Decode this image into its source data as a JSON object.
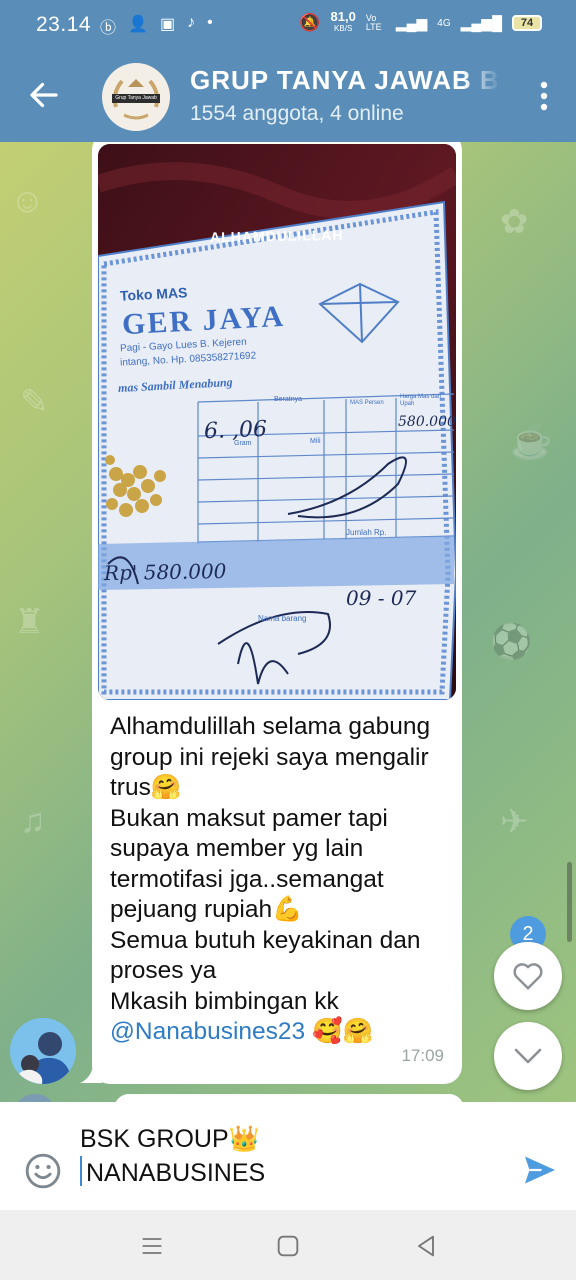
{
  "status_bar": {
    "time": "23.14",
    "speed": "81,0",
    "speed_unit": "KB/S",
    "volte": "Vo LTE",
    "network": "4G",
    "battery": "74"
  },
  "header": {
    "title": "GRUP TANYA JAWAB BSK",
    "subtitle": "1554 anggota, 4 online",
    "avatar_text": "Grup Tanya Jawab"
  },
  "message": {
    "image_caption": "ALHAMDULILLAH",
    "receipt": {
      "shop_label": "Toko MAS",
      "shop_name": "GER JAYA",
      "address": "Pagi - Gayo Lues B. Kejeren",
      "phone": "intang, No. Hp. 085358271692",
      "slogan": "mas Sambil Menabung",
      "col_heavy": "Beratnya",
      "col_mas": "MAS Persen",
      "col_price": "Harga Mas dan Upah",
      "row_unit": "Gram",
      "row_mili": "Mili",
      "total_label": "Jumlah Rp.",
      "handwritten_weight": "6. ,06",
      "handwritten_price": "580.000",
      "handwritten_total": "Rp' 580.000",
      "handwritten_date": "09 - 07",
      "name_label": "Nama barang"
    },
    "lines": [
      "Alhamdulillah selama gabung",
      "group ini rejeki saya mengalir",
      "trus🤗",
      "Bukan maksut pamer tapi",
      "supaya member yg lain",
      "termotifasi jga..semangat",
      "pejuang rupiah💪",
      "Semua butuh keyakinan dan",
      "proses ya",
      "Mkasih bimbingan kk"
    ],
    "mention": "@Nanabusines23",
    "mention_emoji": " 🥰🤗",
    "time": "17:09"
  },
  "reactions": {
    "count": "2"
  },
  "input": {
    "line1": "BSK GROUP👑",
    "line2": "NANABUSINES"
  },
  "colors": {
    "header": "#5a8eb8",
    "accent": "#4e9be0",
    "mention": "#2e7cc6"
  }
}
